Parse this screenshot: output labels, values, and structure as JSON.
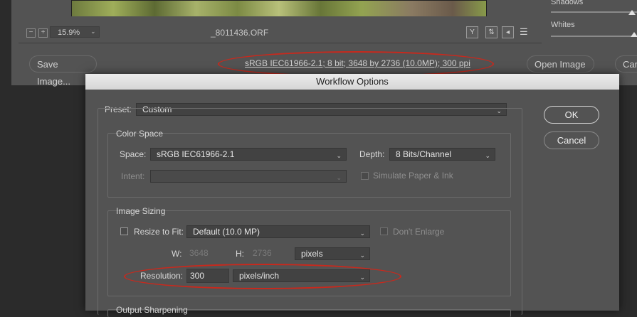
{
  "window": {
    "zoom": "15.9%",
    "filename": "_8011436.ORF",
    "zoom_minus": "−",
    "zoom_plus": "+",
    "right_panel": {
      "shadows_label": "Shadows",
      "whites_label": "Whites"
    },
    "save_image_label": "Save Image...",
    "image_info": "sRGB IEC61966-2.1; 8 bit; 3648 by 2736 (10.0MP); 300 ppi",
    "open_image_label": "Open Image",
    "cancel_partial": "Can"
  },
  "dialog": {
    "title": "Workflow Options",
    "preset_label": "Preset:",
    "preset_value": "Custom",
    "ok_label": "OK",
    "cancel_label": "Cancel",
    "color_space": {
      "title": "Color Space",
      "space_label": "Space:",
      "space_value": "sRGB IEC61966-2.1",
      "depth_label": "Depth:",
      "depth_value": "8 Bits/Channel",
      "intent_label": "Intent:",
      "intent_value": "",
      "simulate_label": "Simulate Paper & Ink"
    },
    "image_sizing": {
      "title": "Image Sizing",
      "resize_label": "Resize to Fit:",
      "resize_value": "Default  (10.0 MP)",
      "dont_enlarge_label": "Don't Enlarge",
      "w_label": "W:",
      "w_value": "3648",
      "h_label": "H:",
      "h_value": "2736",
      "unit_value": "pixels",
      "resolution_label": "Resolution:",
      "resolution_value": "300",
      "resolution_unit": "pixels/inch"
    },
    "output_sharpening": {
      "title": "Output Sharpening"
    }
  },
  "colors": {
    "annotation": "#c8291d",
    "panel": "#535353",
    "field": "#424242"
  }
}
